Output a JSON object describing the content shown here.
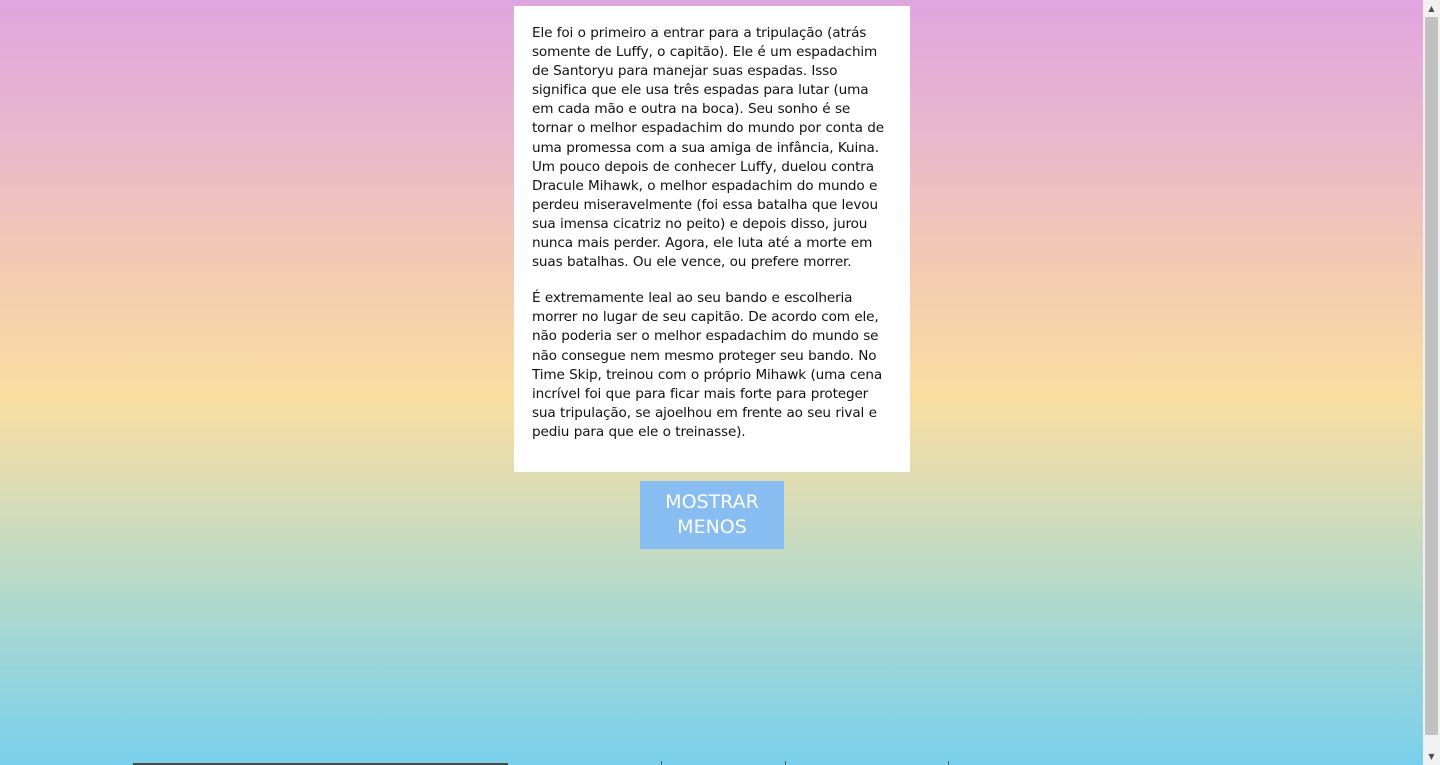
{
  "card": {
    "paragraphs": [
      "Ele foi o primeiro a entrar para a tripulação (atrás somente de Luffy, o capitão). Ele é um espadachim de Santoryu para manejar suas espadas. Isso significa que ele usa três espadas para lutar (uma em cada mão e outra na boca). Seu sonho é se tornar o melhor espadachim do mundo por conta de uma promessa com a sua amiga de infância, Kuina. Um pouco depois de conhecer Luffy, duelou contra Dracule Mihawk, o melhor espadachim do mundo e perdeu miseravelmente (foi essa batalha que levou sua imensa cicatriz no peito) e depois disso, jurou nunca mais perder. Agora, ele luta até a morte em suas batalhas. Ou ele vence, ou prefere morrer.",
      "É extremamente leal ao seu bando e escolheria morrer no lugar de seu capitão. De acordo com ele, não poderia ser o melhor espadachim do mundo se não consegue nem mesmo proteger seu bando. No Time Skip, treinou com o próprio Mihawk (uma cena incrível foi que para ficar mais forte para proteger sua tripulação, se ajoelhou em frente ao seu rival e pediu para que ele o treinasse)."
    ]
  },
  "toggle_button": {
    "label": "MOSTRAR MENOS"
  },
  "scrollbar": {
    "up_icon": "▲",
    "down_icon": "▼"
  },
  "colors": {
    "button_bg": "#87bdf0",
    "gradient_top": "#dfa5e0",
    "gradient_mid": "#f9dea1",
    "gradient_bottom": "#79d0ec"
  }
}
